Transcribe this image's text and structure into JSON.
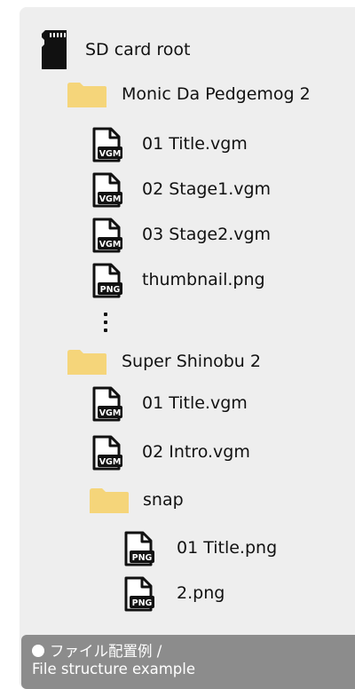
{
  "tree": {
    "root": {
      "label": "SD card root",
      "icon": "sd-card-icon"
    },
    "folder1": {
      "label": "Monic Da Pedgemog 2",
      "icon": "folder-icon"
    },
    "folder1_files": [
      {
        "label": "01 Title.vgm",
        "badge": "VGM"
      },
      {
        "label": "02 Stage1.vgm",
        "badge": "VGM"
      },
      {
        "label": "03 Stage2.vgm",
        "badge": "VGM"
      },
      {
        "label": "thumbnail.png",
        "badge": "PNG"
      }
    ],
    "folder2": {
      "label": "Super Shinobu 2",
      "icon": "folder-icon"
    },
    "folder2_files": [
      {
        "label": "01 Title.vgm",
        "badge": "VGM"
      },
      {
        "label": "02 Intro.vgm",
        "badge": "VGM"
      }
    ],
    "subfolder": {
      "label": "snap",
      "icon": "folder-icon"
    },
    "subfolder_files": [
      {
        "label": "01 Title.png",
        "badge": "PNG"
      },
      {
        "label": "2.png",
        "badge": "PNG"
      }
    ]
  },
  "caption": {
    "line1": "ファイル配置例 /",
    "line2": "File structure example"
  },
  "colors": {
    "folder": "#f5d57a",
    "panel": "#eeeeee",
    "caption_bg": "#8c8c8c",
    "icon": "#111111"
  }
}
